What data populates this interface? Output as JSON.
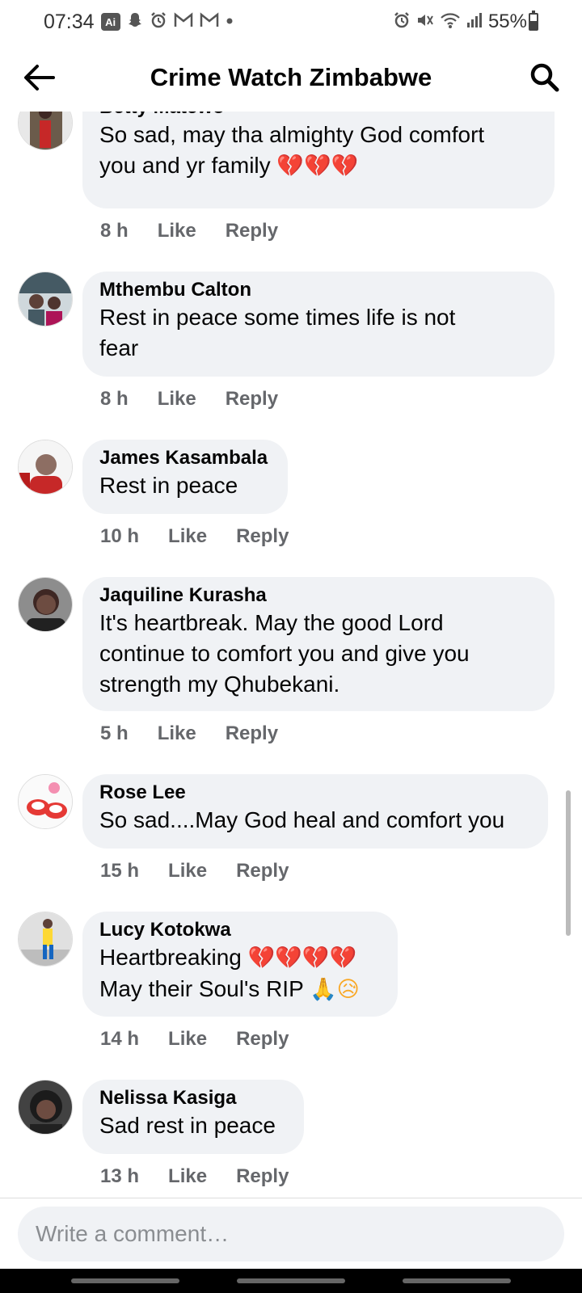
{
  "status_bar": {
    "time": "07:34",
    "ai_badge": "Ai",
    "battery": "55%",
    "battery_level": 0.55,
    "left_icons": [
      "ai-icon",
      "snapchat-icon",
      "alarm-icon",
      "gmail-icon",
      "gmail-icon",
      "dot-icon"
    ],
    "right_icons": [
      "alarm-icon",
      "mute-icon",
      "wifi-icon",
      "signal-icon"
    ]
  },
  "header": {
    "title": "Crime Watch Zimbabwe",
    "back_icon": "back-arrow-icon",
    "search_icon": "search-icon"
  },
  "actions": {
    "like": "Like",
    "reply": "Reply"
  },
  "comments": [
    {
      "author": "Betty Matewo",
      "text": "So sad, may tha almighty God comfort\nyou and yr family ",
      "emoji": "💔💔💔",
      "time": "8 h"
    },
    {
      "author": "Mthembu Calton",
      "text": "Rest in peace  some times life  is not\nfear",
      "time": "8 h"
    },
    {
      "author": "James Kasambala",
      "text": "Rest in peace",
      "time": "10 h"
    },
    {
      "author": "Jaquiline Kurasha",
      "text": "It's heartbreak. May the good Lord\ncontinue to comfort you and give you\nstrength my Qhubekani.",
      "time": "5 h"
    },
    {
      "author": "Rose Lee",
      "text": "So sad....May God heal and comfort you",
      "time": "15 h"
    },
    {
      "author": "Lucy Kotokwa",
      "text": "Heartbreaking ",
      "emoji": "💔💔💔💔",
      "text2": "May their Soul's RIP ",
      "emoji2": "🙏😥",
      "time": "14 h"
    },
    {
      "author": "Nelissa Kasiga",
      "text": "Sad rest in peace",
      "time": "13 h"
    }
  ],
  "composer": {
    "placeholder": "Write a comment…"
  },
  "colors": {
    "bubble": "#f0f2f5",
    "meta": "#65676b",
    "text": "#050505"
  }
}
